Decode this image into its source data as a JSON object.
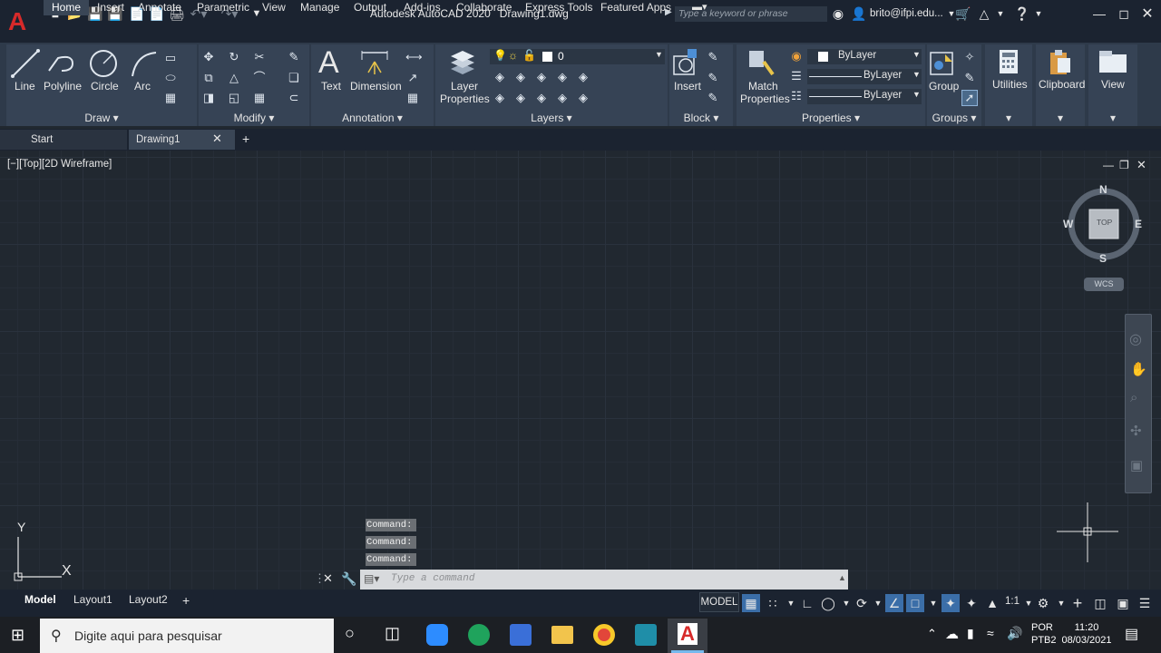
{
  "window": {
    "title": "Autodesk AutoCAD 2020",
    "document": "Drawing1.dwg",
    "search_placeholder": "Type a keyword or phrase",
    "user": "brito@ifpi.edu...",
    "logo_letter": "A"
  },
  "ribbon_tabs": [
    "Home",
    "Insert",
    "Annotate",
    "Parametric",
    "View",
    "Manage",
    "Output",
    "Add-ins",
    "Collaborate",
    "Express Tools",
    "Featured Apps"
  ],
  "panels": {
    "draw": {
      "title": "Draw",
      "tools": [
        "Line",
        "Polyline",
        "Circle",
        "Arc"
      ]
    },
    "modify": {
      "title": "Modify"
    },
    "annotation": {
      "title": "Annotation",
      "tools": [
        "Text",
        "Dimension"
      ]
    },
    "layers": {
      "title": "Layers",
      "layer_properties_1": "Layer",
      "layer_properties_2": "Properties",
      "current_layer": "0"
    },
    "block": {
      "title": "Block",
      "insert": "Insert"
    },
    "properties": {
      "title": "Properties",
      "match_1": "Match",
      "match_2": "Properties",
      "color": "ByLayer",
      "linetype": "ByLayer",
      "lineweight": "ByLayer"
    },
    "groups": {
      "title": "Groups",
      "group": "Group"
    },
    "utilities": {
      "title": "Utilities"
    },
    "clipboard": {
      "title": "Clipboard"
    },
    "view": {
      "title": "View"
    }
  },
  "doc_tabs": {
    "start": "Start",
    "drawing": "Drawing1"
  },
  "viewport": {
    "label": "[−][Top][2D Wireframe]",
    "viewcube": {
      "top": "TOP",
      "north": "N",
      "south": "S",
      "east": "E",
      "west": "W",
      "wcs": "WCS"
    },
    "ucs_x": "X",
    "ucs_y": "Y"
  },
  "command_line": {
    "history": [
      "Command:",
      "Command:",
      "Command:"
    ],
    "placeholder": "Type a command"
  },
  "layout_tabs": [
    "Model",
    "Layout1",
    "Layout2"
  ],
  "status_bar": {
    "model": "MODEL",
    "scale": "1:1"
  },
  "taskbar": {
    "search_placeholder": "Digite aqui para pesquisar",
    "lang_1": "POR",
    "lang_2": "PTB2",
    "time": "11:20",
    "date": "08/03/2021"
  }
}
